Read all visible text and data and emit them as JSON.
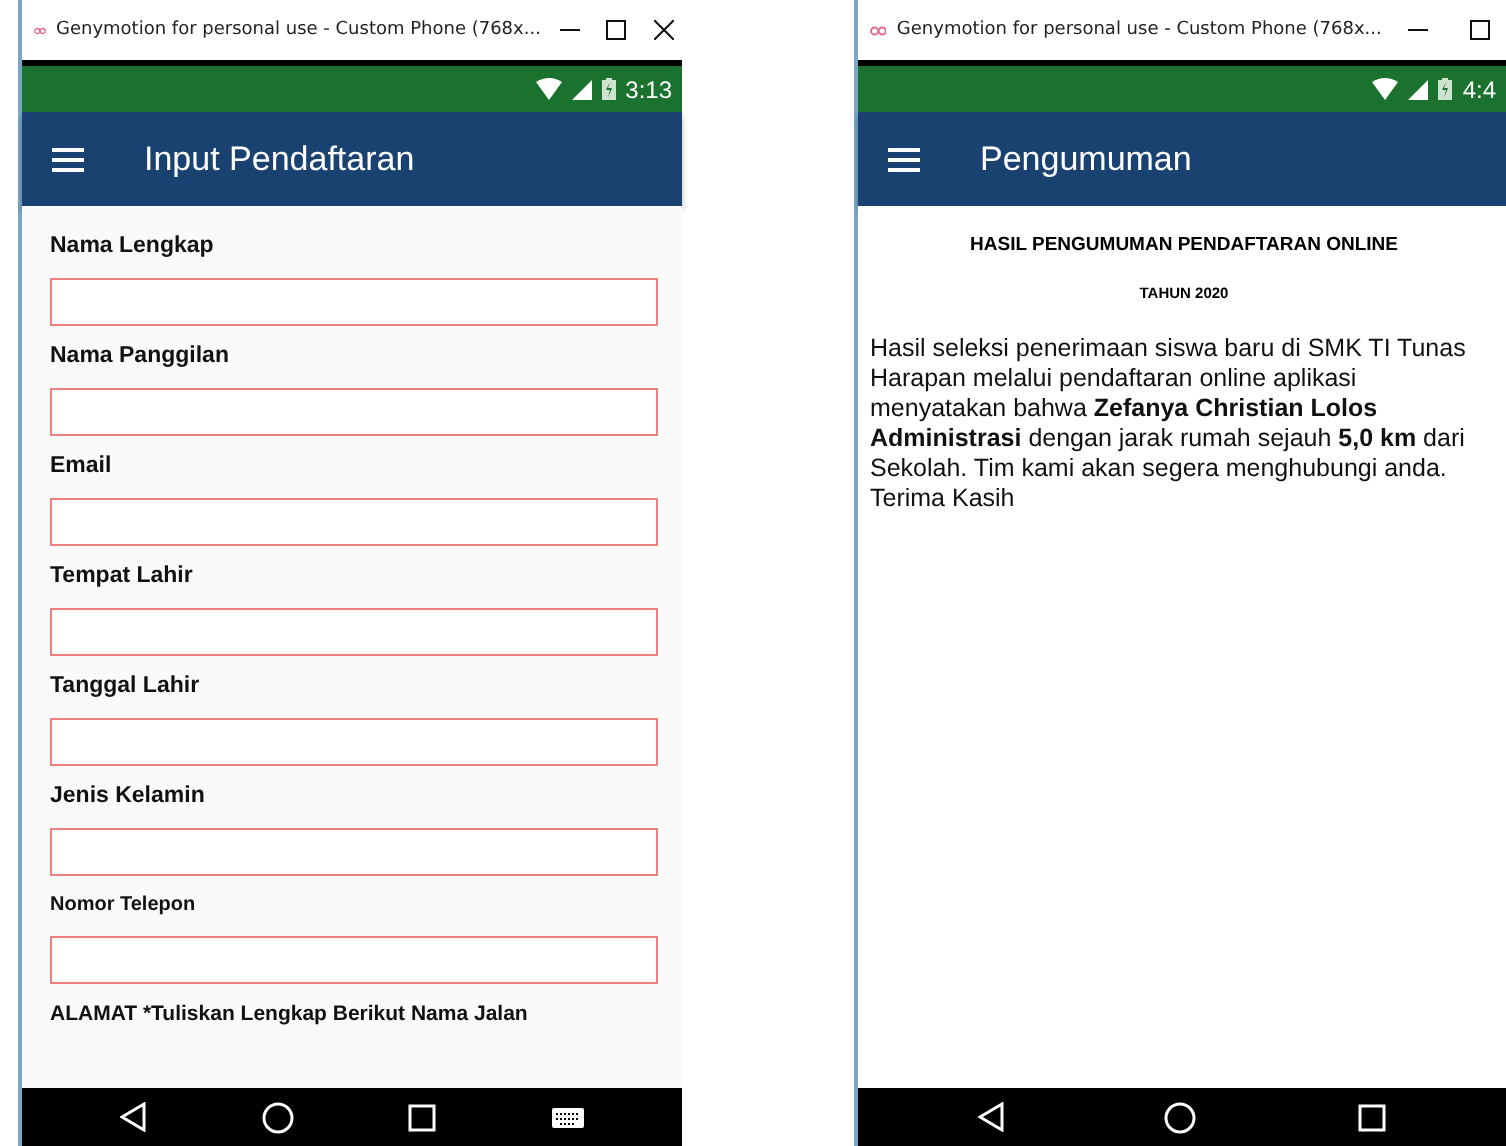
{
  "phones": [
    {
      "window": {
        "title": "Genymotion for personal use - Custom Phone (768x..."
      },
      "status_bar": {
        "time": "3:13"
      },
      "app_bar": {
        "title": "Input Pendaftaran"
      },
      "kind": "form",
      "form": {
        "fields": [
          {
            "label": "Nama Lengkap"
          },
          {
            "label": "Nama Panggilan"
          },
          {
            "label": "Email"
          },
          {
            "label": "Tempat Lahir"
          },
          {
            "label": "Tanggal Lahir"
          },
          {
            "label": "Jenis Kelamin"
          },
          {
            "label": "Nomor Telepon"
          }
        ],
        "trailing_label": "ALAMAT *Tuliskan Lengkap Berikut Nama Jalan"
      },
      "nav_buttons": [
        {
          "kind": "back"
        },
        {
          "kind": "home"
        },
        {
          "kind": "recents"
        },
        {
          "kind": "keyboard"
        }
      ],
      "close_visible": true
    },
    {
      "window": {
        "title": "Genymotion for personal use - Custom Phone (768x..."
      },
      "status_bar": {
        "time": "4:4"
      },
      "app_bar": {
        "title": "Pengumuman"
      },
      "kind": "announcement",
      "announcement": {
        "heading": "HASIL PENGUMUMAN PENDAFTARAN ONLINE",
        "year": "TAHUN 2020",
        "body": "Hasil seleksi penerimaan siswa baru di SMK TI Tunas Harapan melalui pendaftaran online aplikasi menyatakan bahwa **Zefanya Christian Lolos Administrasi** dengan jarak rumah sejauh **5,0 km** dari Sekolah. Tim kami akan segera menghubungi anda. Terima Kasih"
      },
      "nav_buttons": [
        {
          "kind": "back"
        },
        {
          "kind": "home"
        },
        {
          "kind": "recents"
        }
      ],
      "close_visible": false
    }
  ]
}
